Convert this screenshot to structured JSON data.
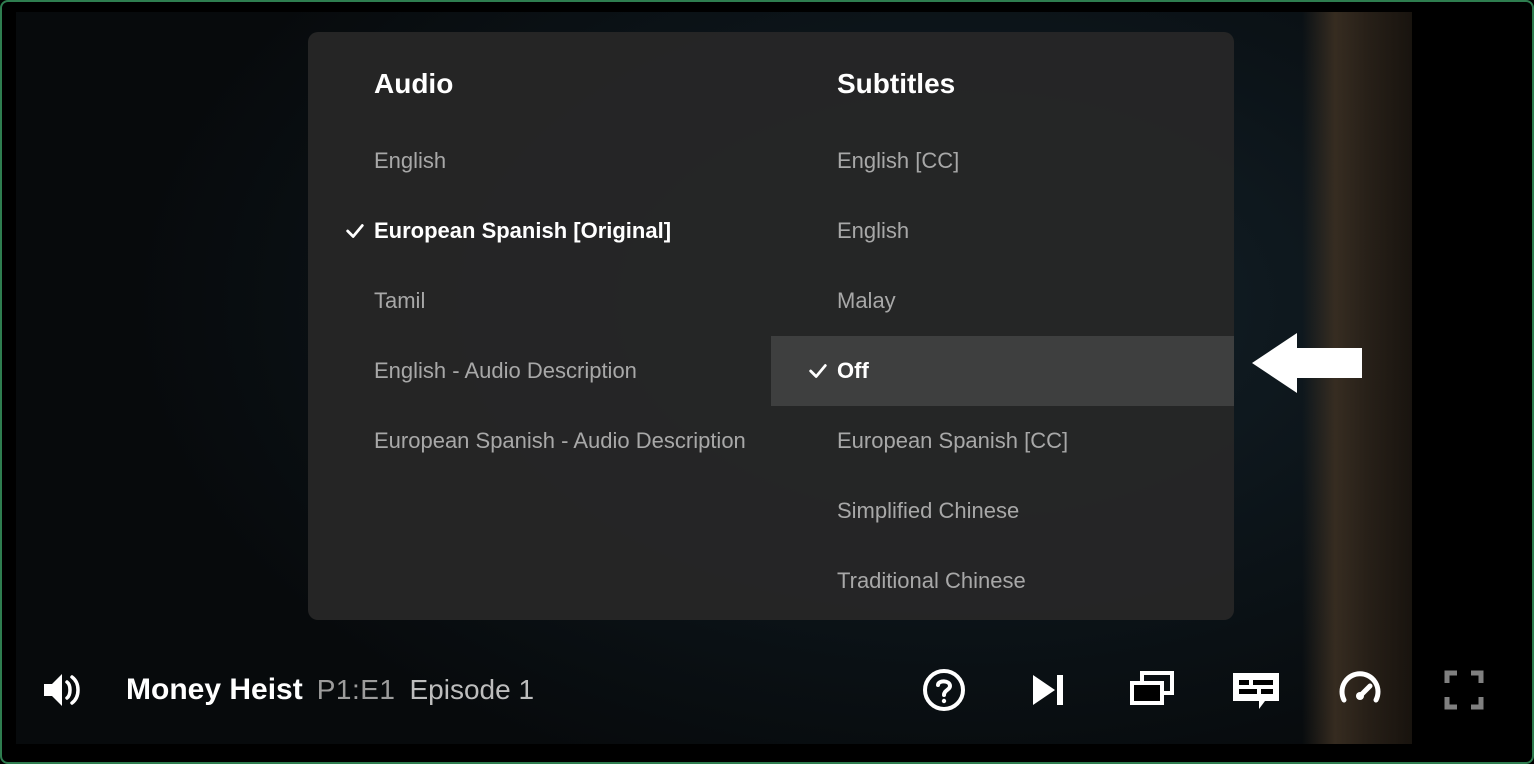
{
  "popup": {
    "audio": {
      "header": "Audio",
      "options": [
        {
          "label": "English",
          "selected": false
        },
        {
          "label": "European Spanish [Original]",
          "selected": true
        },
        {
          "label": "Tamil",
          "selected": false
        },
        {
          "label": "English - Audio Description",
          "selected": false
        },
        {
          "label": "European Spanish - Audio Description",
          "selected": false
        }
      ]
    },
    "subtitles": {
      "header": "Subtitles",
      "options": [
        {
          "label": "English [CC]",
          "selected": false
        },
        {
          "label": "English",
          "selected": false
        },
        {
          "label": "Malay",
          "selected": false
        },
        {
          "label": "Off",
          "selected": true,
          "highlight": true
        },
        {
          "label": "European Spanish [CC]",
          "selected": false
        },
        {
          "label": "Simplified Chinese",
          "selected": false
        },
        {
          "label": "Traditional Chinese",
          "selected": false
        }
      ]
    }
  },
  "player": {
    "show_title": "Money Heist",
    "episode_code": "P1:E1",
    "episode_name": "Episode 1"
  }
}
